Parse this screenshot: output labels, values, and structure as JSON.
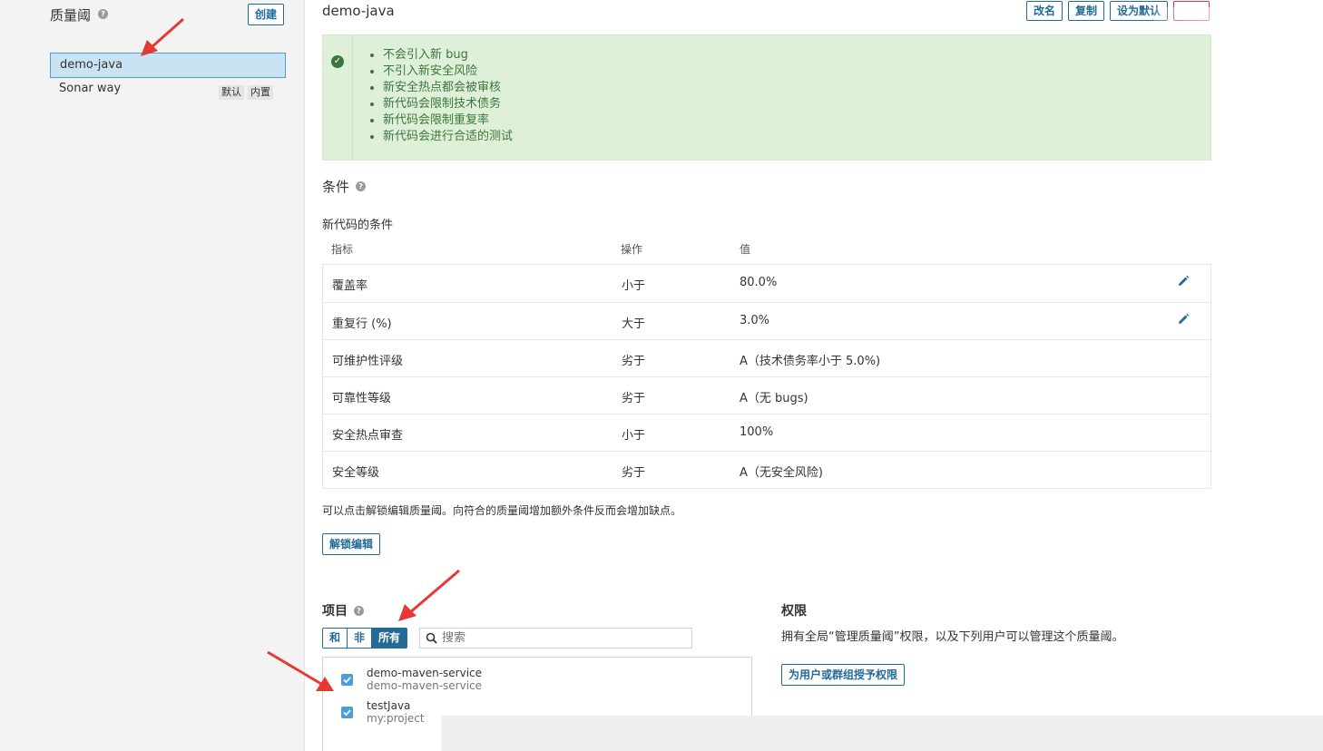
{
  "sidebar": {
    "title": "质量阈",
    "help": "?",
    "create_label": "创建",
    "items": [
      {
        "label": "demo-java"
      },
      {
        "label": "Sonar way",
        "badges": [
          "默认",
          "内置"
        ]
      }
    ]
  },
  "header": {
    "title": "demo-java",
    "actions": [
      "改名",
      "复制",
      "设为默认",
      ""
    ]
  },
  "success": {
    "items": [
      "不会引入新 bug",
      "不引入新安全风险",
      "新安全热点都会被审核",
      "新代码会限制技术债务",
      "新代码会限制重复率",
      "新代码会进行合适的测试"
    ]
  },
  "conditions": {
    "title": "条件",
    "subtitle": "新代码的条件",
    "columns": [
      "指标",
      "操作",
      "值"
    ],
    "rows": [
      {
        "metric": "覆盖率",
        "op": "小于",
        "value": "80.0%",
        "editable": true
      },
      {
        "metric": "重复行 (%)",
        "op": "大于",
        "value": "3.0%",
        "editable": true
      },
      {
        "metric": "可维护性评级",
        "op": "劣于",
        "value": "A（技术债务率小于 5.0%)",
        "editable": false
      },
      {
        "metric": "可靠性等级",
        "op": "劣于",
        "value": "A（无 bugs)",
        "editable": false
      },
      {
        "metric": "安全热点审查",
        "op": "小于",
        "value": "100%",
        "editable": false
      },
      {
        "metric": "安全等级",
        "op": "劣于",
        "value": "A（无安全风险)",
        "editable": false
      }
    ],
    "note": "可以点击解锁编辑质量阈。向符合的质量阈增加额外条件反而会增加缺点。",
    "unlock_label": "解锁编辑"
  },
  "projects": {
    "title": "项目",
    "filters": [
      "和",
      "非",
      "所有"
    ],
    "selected_filter": "所有",
    "search_placeholder": "搜索",
    "items": [
      {
        "name": "demo-maven-service",
        "key": "demo-maven-service",
        "checked": true
      },
      {
        "name": "testJava",
        "key": "my:project",
        "checked": true
      }
    ]
  },
  "permissions": {
    "title": "权限",
    "description": "拥有全局“管理质量阈”权限，以及下列用户可以管理这个质量阈。",
    "grant_label": "为用户或群组授予权限"
  },
  "colors": {
    "accent": "#236a97",
    "selected_bg": "#cae3f2",
    "success_bg": "#dff0d8",
    "success_text": "#3c763d",
    "danger": "#d4333f",
    "annotation_arrow": "#e53935"
  }
}
